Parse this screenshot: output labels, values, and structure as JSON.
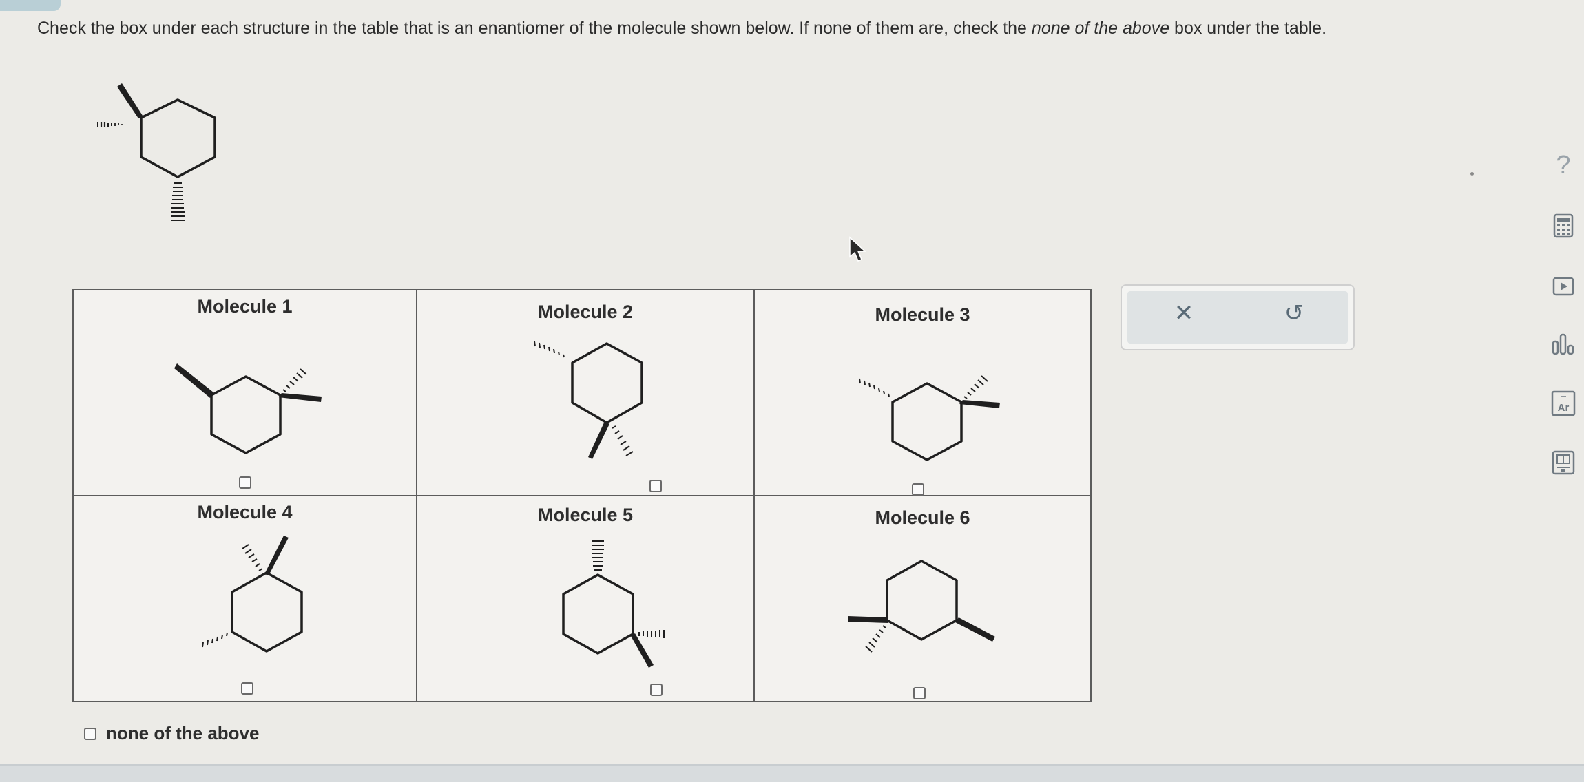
{
  "question": {
    "part1": "Check the box under each structure in the table that is an enantiomer of the molecule shown below. If none of them are, check the ",
    "emphasis": "none of the above",
    "part2": " box under the table."
  },
  "table": {
    "cells": [
      {
        "label": "Molecule 1",
        "checked": false
      },
      {
        "label": "Molecule 2",
        "checked": false
      },
      {
        "label": "Molecule 3",
        "checked": false
      },
      {
        "label": "Molecule 4",
        "checked": false
      },
      {
        "label": "Molecule 5",
        "checked": false
      },
      {
        "label": "Molecule 6",
        "checked": false
      }
    ]
  },
  "none_of_the_above": {
    "label": "none of the above",
    "checked": false
  },
  "actions": {
    "clear_symbol": "✕",
    "undo_symbol": "↺"
  },
  "side_tools": {
    "help_symbol": "?",
    "items": [
      "calculator-icon",
      "video-play-icon",
      "chart-bars-icon",
      "periodic-table-icon",
      "textbook-icon"
    ],
    "periodic_table_text": "Ar"
  },
  "colors": {
    "ink": "#1f1f1f",
    "panel": "#dfe3e4",
    "accent": "#5a6b77"
  }
}
